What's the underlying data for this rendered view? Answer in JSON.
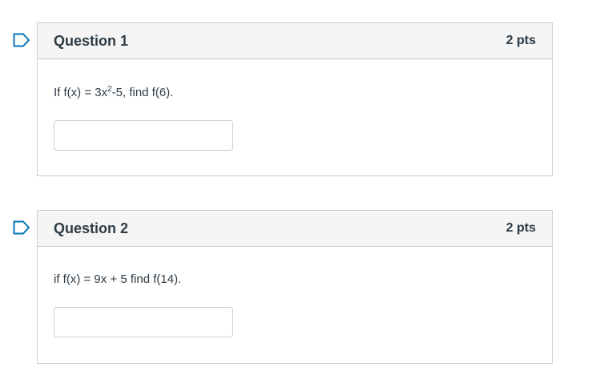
{
  "questions": [
    {
      "title": "Question 1",
      "points": "2 pts",
      "text_before": "If f(x) = 3x",
      "text_sup": "2",
      "text_after": "-5, find f(6).",
      "answer_value": "",
      "flag_icon": "bookmark-flag-icon"
    },
    {
      "title": "Question 2",
      "points": "2 pts",
      "text_before": "if f(x) = 9x + 5 find f(14).",
      "text_sup": "",
      "text_after": "",
      "answer_value": "",
      "flag_icon": "bookmark-flag-icon"
    }
  ],
  "colors": {
    "flag": "#0374b5",
    "border": "#c7cdd1",
    "header_bg": "#f5f5f5",
    "text": "#2d3b45"
  }
}
